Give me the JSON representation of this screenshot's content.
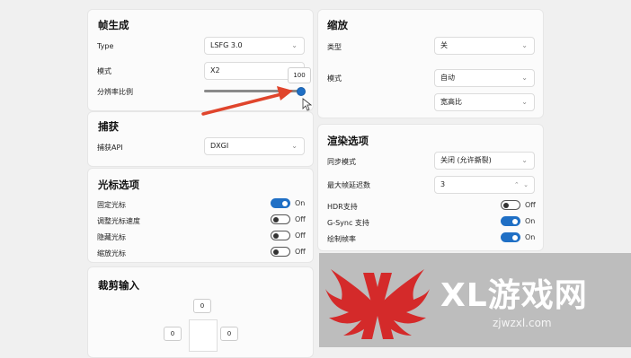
{
  "frame_gen": {
    "title": "帧生成",
    "type_label": "Type",
    "type_value": "LSFG 3.0",
    "mode_label": "模式",
    "mode_value": "X2",
    "resolution_label": "分辨率比例",
    "resolution_tooltip": "100",
    "resolution_value_pct": 100
  },
  "capture": {
    "title": "捕获",
    "api_label": "捕获API",
    "api_value": "DXGI"
  },
  "cursor": {
    "title": "光标选项",
    "items": [
      {
        "label": "固定光标",
        "state": "On",
        "on": true
      },
      {
        "label": "调整光标速度",
        "state": "Off",
        "on": false
      },
      {
        "label": "隐藏光标",
        "state": "Off",
        "on": false
      },
      {
        "label": "缩放光标",
        "state": "Off",
        "on": false
      }
    ]
  },
  "crop": {
    "title": "裁剪输入",
    "top": "0",
    "left": "0",
    "right": "0"
  },
  "scale": {
    "title": "缩放",
    "type_label": "类型",
    "type_value": "关",
    "mode_label": "模式",
    "mode_value": "自动",
    "aspect_value": "宽高比"
  },
  "render": {
    "title": "渲染选项",
    "sync_label": "同步模式",
    "sync_value": "关闭 (允许撕裂)",
    "maxframes_label": "最大帧延迟数",
    "maxframes_value": "3",
    "toggles": [
      {
        "label": "HDR支持",
        "state": "Off",
        "on": false
      },
      {
        "label": "G-Sync 支持",
        "state": "On",
        "on": true
      },
      {
        "label": "绘制帧率",
        "state": "On",
        "on": true
      }
    ]
  },
  "watermark": {
    "brand": "XL游戏网",
    "url": "zjwzxl.com"
  },
  "colors": {
    "accent": "#1f6fc5",
    "annotation_arrow": "#e0452c",
    "watermark_red": "#d42a2a"
  }
}
